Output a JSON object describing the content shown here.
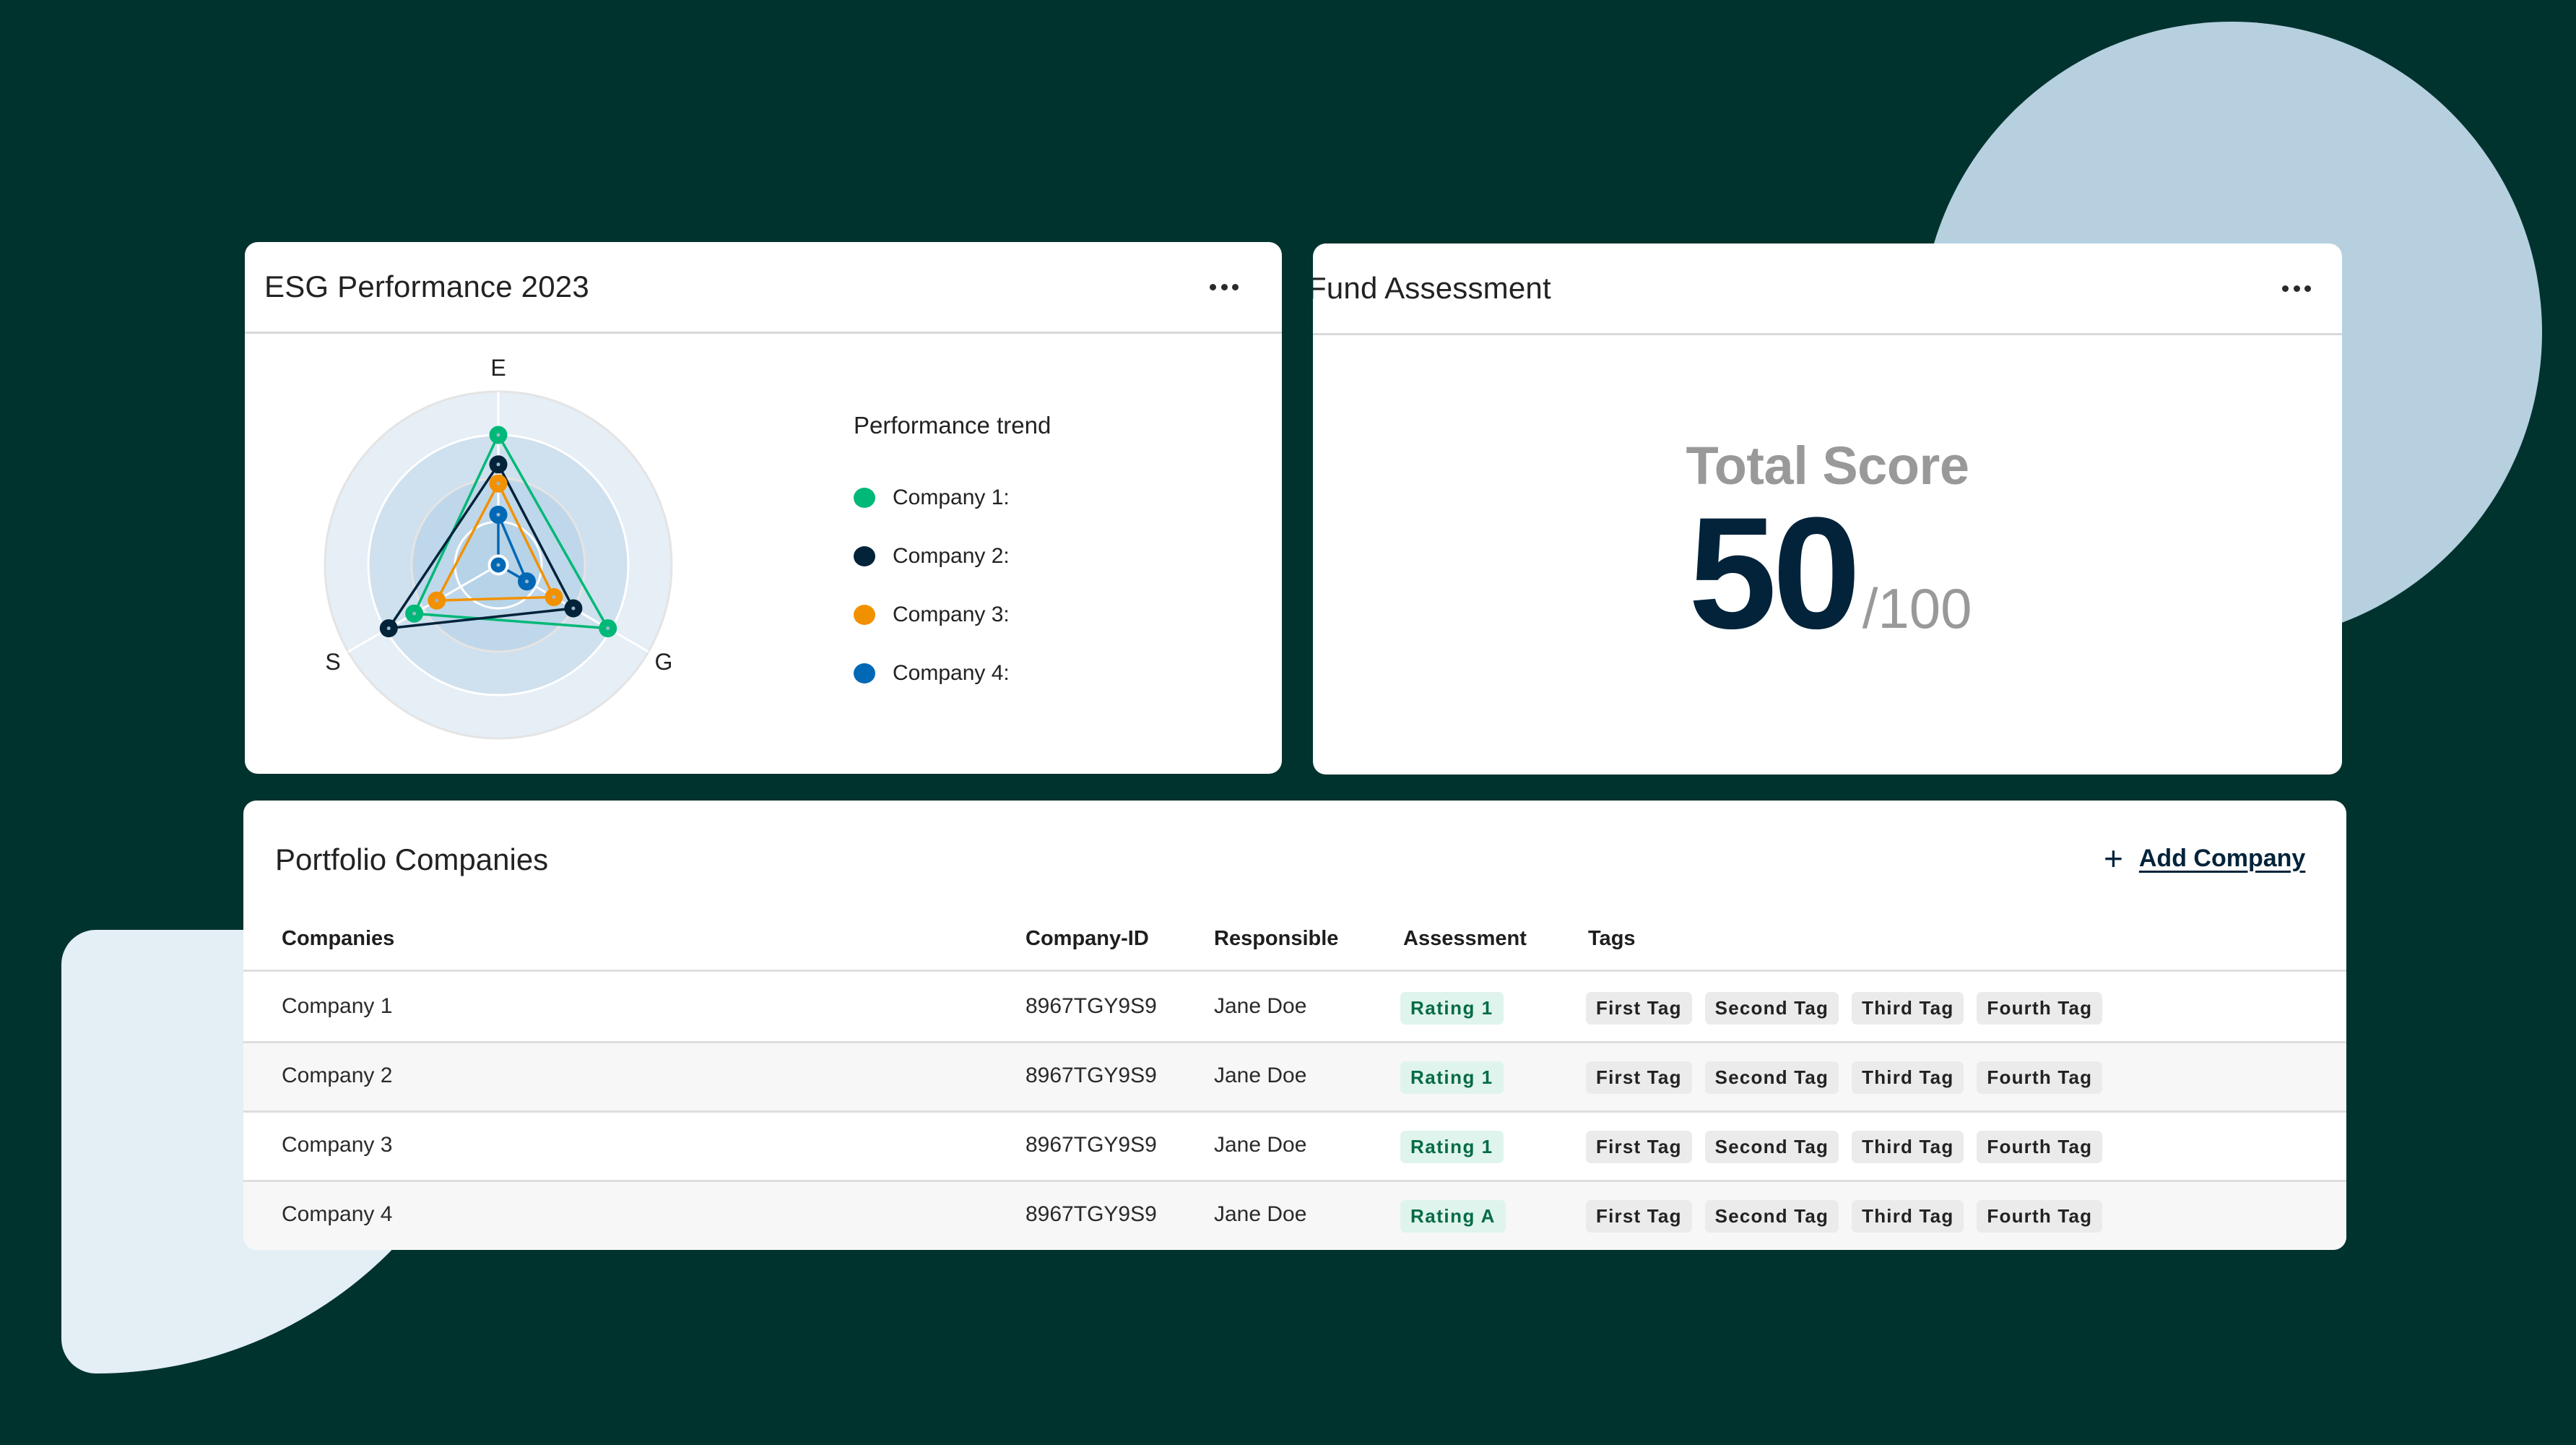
{
  "colors": {
    "background": "#00332e",
    "accent_dark": "#02233a",
    "company1": "#00b877",
    "company2": "#02233a",
    "company3": "#f29100",
    "company4": "#0068b5",
    "rating_bg": "#dff4ec",
    "rating_text": "#056b45",
    "tag_bg": "#ebebeb"
  },
  "esg_card": {
    "title": "ESG Performance 2023",
    "more_icon": "more-horizontal-icon",
    "legend_title": "Performance trend"
  },
  "chart_data": {
    "type": "radar",
    "title": "ESG Performance 2023",
    "axes": [
      "E",
      "G",
      "S"
    ],
    "range": [
      0,
      100
    ],
    "rings": [
      25,
      50,
      75,
      100
    ],
    "legend_title": "Performance trend",
    "legend_position": "right",
    "series": [
      {
        "name": "Company 1:",
        "color": "#00b877",
        "values": {
          "E": 75,
          "G": 73,
          "S": 56
        }
      },
      {
        "name": "Company 2:",
        "color": "#02233a",
        "values": {
          "E": 58,
          "G": 50,
          "S": 73
        }
      },
      {
        "name": "Company 3:",
        "color": "#f29100",
        "values": {
          "E": 47,
          "G": 37,
          "S": 41
        }
      },
      {
        "name": "Company 4:",
        "color": "#0068b5",
        "values": {
          "E": 29,
          "G": 19,
          "S": 0
        }
      }
    ]
  },
  "fund_card": {
    "title": "Fund Assessment",
    "more_icon": "more-horizontal-icon",
    "score_label": "Total Score",
    "score_value": "50",
    "score_max": "/100"
  },
  "portfolio": {
    "title": "Portfolio Companies",
    "add_icon": "plus-icon",
    "add_label": "Add Company",
    "columns": [
      "Companies",
      "Company-ID",
      "Responsible",
      "Assessment",
      "Tags"
    ],
    "rows": [
      {
        "company": "Company 1",
        "id": "8967TGY9S9",
        "responsible": "Jane Doe",
        "assessment": "Rating 1",
        "tags": [
          "First Tag",
          "Second Tag",
          "Third Tag",
          "Fourth Tag"
        ]
      },
      {
        "company": "Company 2",
        "id": "8967TGY9S9",
        "responsible": "Jane Doe",
        "assessment": "Rating 1",
        "tags": [
          "First Tag",
          "Second Tag",
          "Third Tag",
          "Fourth Tag"
        ]
      },
      {
        "company": "Company 3",
        "id": "8967TGY9S9",
        "responsible": "Jane Doe",
        "assessment": "Rating 1",
        "tags": [
          "First Tag",
          "Second Tag",
          "Third Tag",
          "Fourth Tag"
        ]
      },
      {
        "company": "Company 4",
        "id": "8967TGY9S9",
        "responsible": "Jane Doe",
        "assessment": "Rating A",
        "tags": [
          "First Tag",
          "Second Tag",
          "Third Tag",
          "Fourth Tag"
        ]
      }
    ]
  }
}
